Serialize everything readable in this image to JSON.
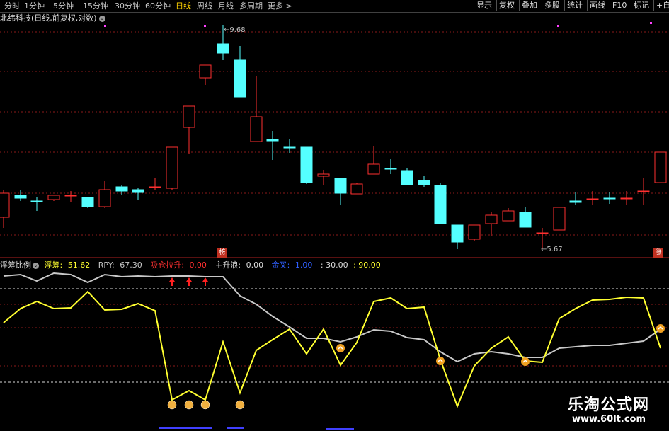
{
  "toolbar": {
    "timeframes": [
      "分时",
      "1分钟",
      "5分钟",
      "15分钟",
      "30分钟",
      "60分钟",
      "日线",
      "周线",
      "月线",
      "多周期",
      "更多"
    ],
    "active_timeframe": "日线",
    "right_buttons": [
      "显示",
      "复权",
      "叠加",
      "多股",
      "统计",
      "画线",
      "F10",
      "标记",
      "+自选"
    ]
  },
  "stock": {
    "title": "北纬科技(日线,前复权,对数)"
  },
  "markers": {
    "high_label": "9.68",
    "low_label": "5.67",
    "badge_bang": "榜",
    "badge_zhang": "涨"
  },
  "indicator": {
    "name": "浮筹比例",
    "fuchou_label": "浮筹:",
    "fuchou_value": "51.62",
    "rpy_label": "RPY:",
    "rpy_value": "67.30",
    "xicang_label": "吸仓拉升:",
    "xicang_value": "0.00",
    "zhusheng_label": "主升浪:",
    "zhusheng_value": "0.00",
    "jincha_label": "金叉:",
    "jincha_value": "1.00",
    "level_a": ": 30.00",
    "level_b": ": 90.00"
  },
  "watermark": {
    "brand": "乐淘公式网",
    "url": "www.60lt.com"
  },
  "colors": {
    "up": "#ff3030",
    "down": "#54ffff",
    "fuchou": "#ffff30",
    "rpy": "#c8c8c8",
    "dashed": "#8b1a1a"
  }
}
